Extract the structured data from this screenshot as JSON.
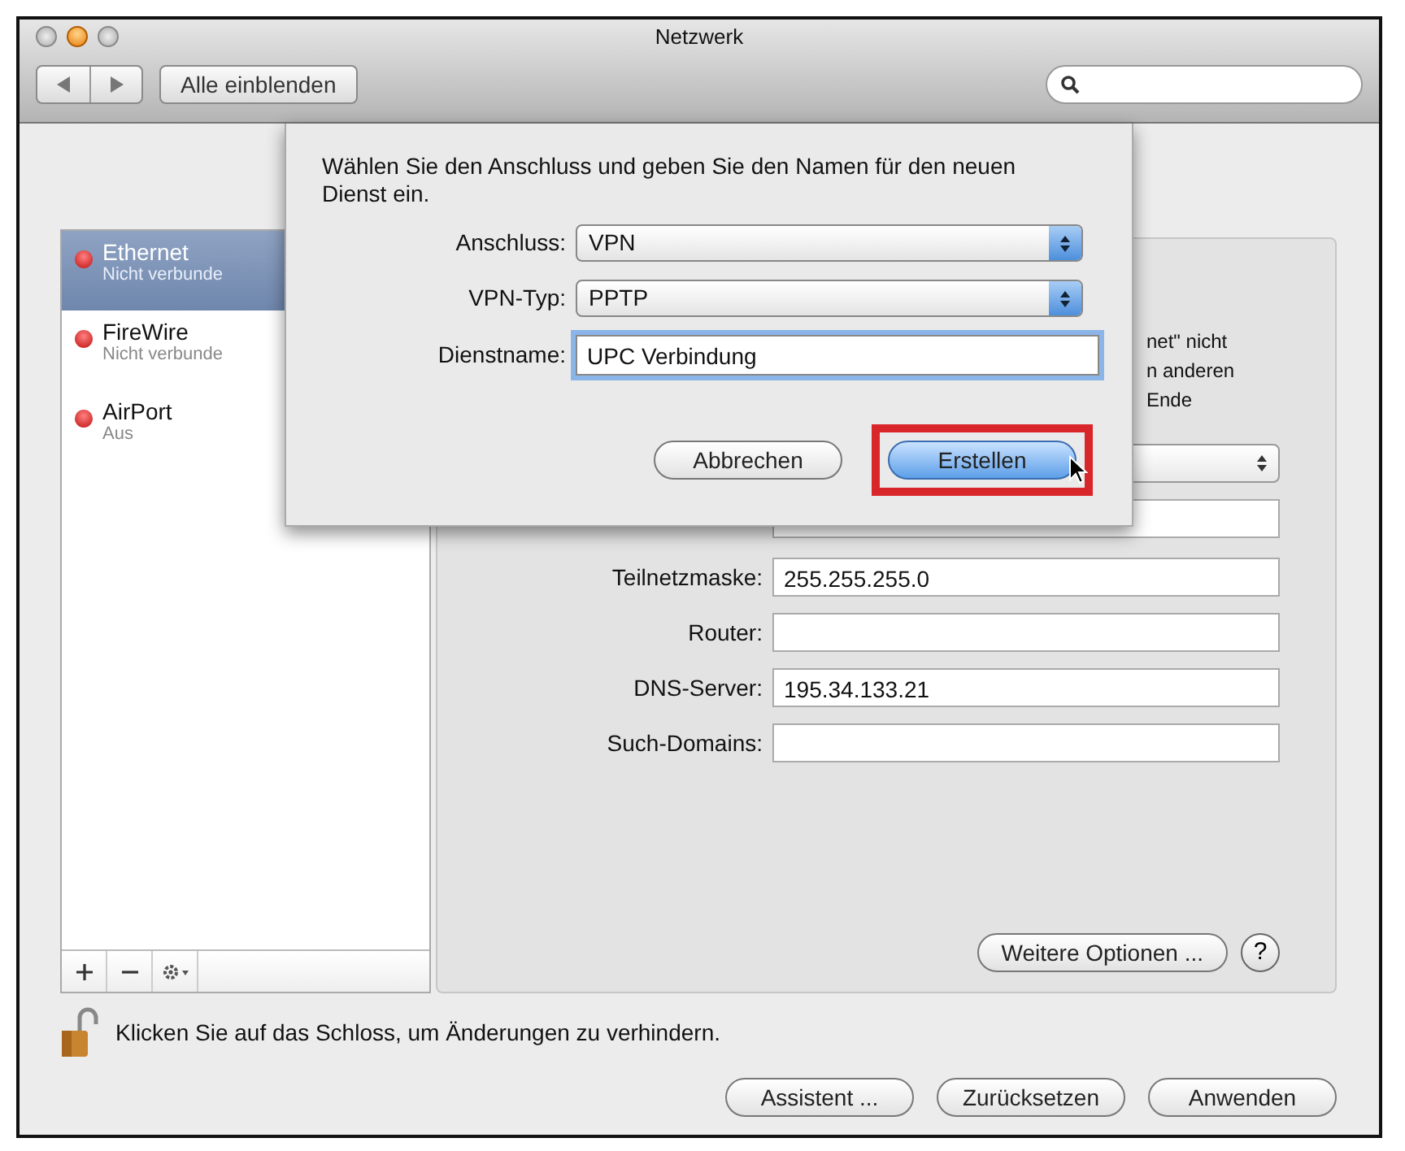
{
  "window": {
    "title": "Netzwerk"
  },
  "toolbar": {
    "show_all_button": "Alle einblenden"
  },
  "services": [
    {
      "name": "Ethernet",
      "status": "Nicht verbunde",
      "selected": true
    },
    {
      "name": "FireWire",
      "status": "Nicht verbunde",
      "selected": false
    },
    {
      "name": "AirPort",
      "status": "Aus",
      "selected": false
    }
  ],
  "panel": {
    "status_lines": [
      "net\" nicht",
      "n anderen Ende"
    ],
    "rows": [
      {
        "kind": "select"
      },
      {
        "kind": "field"
      },
      {
        "kind": "field",
        "label": "Teilnetzmaske:",
        "value": "255.255.255.0"
      },
      {
        "kind": "field",
        "label": "Router:"
      },
      {
        "kind": "field",
        "label": "DNS-Server:",
        "value": "195.34.133.21"
      },
      {
        "kind": "field",
        "label": "Such-Domains:"
      }
    ],
    "more_options_button": "Weitere Optionen ...",
    "help_button": "?"
  },
  "lock_text": "Klicken Sie auf das Schloss, um Änderungen zu verhindern.",
  "buttons": [
    "Assistent ...",
    "Zurücksetzen",
    "Anwenden"
  ],
  "dialog": {
    "message": "Wählen Sie den Anschluss und geben Sie den Namen für den neuen Dienst ein.",
    "rows": [
      {
        "kind": "select",
        "label": "Anschluss:",
        "value": "VPN"
      },
      {
        "kind": "select",
        "label": "VPN-Typ:",
        "value": "PPTP"
      },
      {
        "kind": "field",
        "label": "Dienstname:",
        "value": "UPC Verbindung",
        "focused": true
      }
    ],
    "buttons": [
      {
        "label": "Abbrechen",
        "default": false,
        "highlighted": false
      },
      {
        "label": "Erstellen",
        "default": true,
        "highlighted": true
      }
    ]
  }
}
